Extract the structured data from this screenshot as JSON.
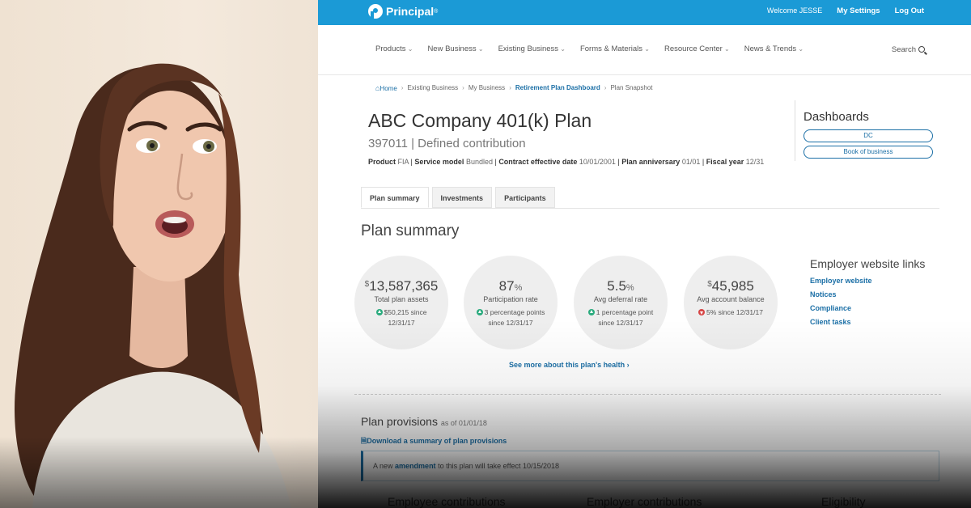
{
  "site": {
    "brand": "Principal",
    "brand_mark": "®",
    "welcome": "Welcome JESSE",
    "my_settings": "My Settings",
    "log_out": "Log Out",
    "nav": [
      "Products",
      "New Business",
      "Existing Business",
      "Forms & Materials",
      "Resource Center",
      "News & Trends"
    ],
    "search_label": "Search",
    "breadcrumb": [
      "Home",
      "Existing Business",
      "My Business",
      "Retirement Plan Dashboard",
      "Plan Snapshot"
    ],
    "plan": {
      "title": "ABC Company 401(k) Plan",
      "subtitle": "397011 | Defined contribution",
      "meta": {
        "product_label": "Product",
        "product": "FIA",
        "service_label": "Service model",
        "service": "Bundled",
        "effective_label": "Contract effective date",
        "effective": "10/01/2001",
        "anniversary_label": "Plan anniversary",
        "anniversary": "01/01",
        "fiscal_label": "Fiscal year",
        "fiscal": "12/31"
      }
    },
    "dashboards": {
      "title": "Dashboards",
      "buttons": [
        "DC",
        "Book of business"
      ]
    },
    "tabs": [
      "Plan summary",
      "Investments",
      "Participants"
    ],
    "summary_title": "Plan summary",
    "metrics": [
      {
        "prefix": "$",
        "value": "13,587,365",
        "suffix": "",
        "label": "Total plan assets",
        "change": "$50,215 since 12/31/17",
        "direction": "up"
      },
      {
        "prefix": "",
        "value": "87",
        "suffix": "%",
        "label": "Participation rate",
        "change": "3 percentage points since 12/31/17",
        "direction": "up"
      },
      {
        "prefix": "",
        "value": "5.5",
        "suffix": "%",
        "label": "Avg deferral rate",
        "change": "1 percentage point since 12/31/17",
        "direction": "up"
      },
      {
        "prefix": "$",
        "value": "45,985",
        "suffix": "",
        "label": "Avg account balance",
        "change": "5% since 12/31/17",
        "direction": "down"
      }
    ],
    "health_link": "See more about this plan's health ›",
    "employer_links": {
      "title": "Employer website links",
      "links": [
        "Employer website",
        "Notices",
        "Compliance",
        "Client tasks"
      ]
    },
    "provisions": {
      "title": "Plan provisions",
      "as_of": "as of 01/01/18",
      "download": "Download a summary of plan provisions",
      "notice_pre": "A new",
      "notice_link": "amendment",
      "notice_post": "to this plan will take effect 10/15/2018",
      "columns": [
        "Employee contributions",
        "Employer contributions",
        "Eligibility"
      ]
    }
  },
  "colors": {
    "topbar": "#1b9ad6",
    "link": "#1b6fa6",
    "up": "#2bab7e",
    "down": "#d64545"
  }
}
